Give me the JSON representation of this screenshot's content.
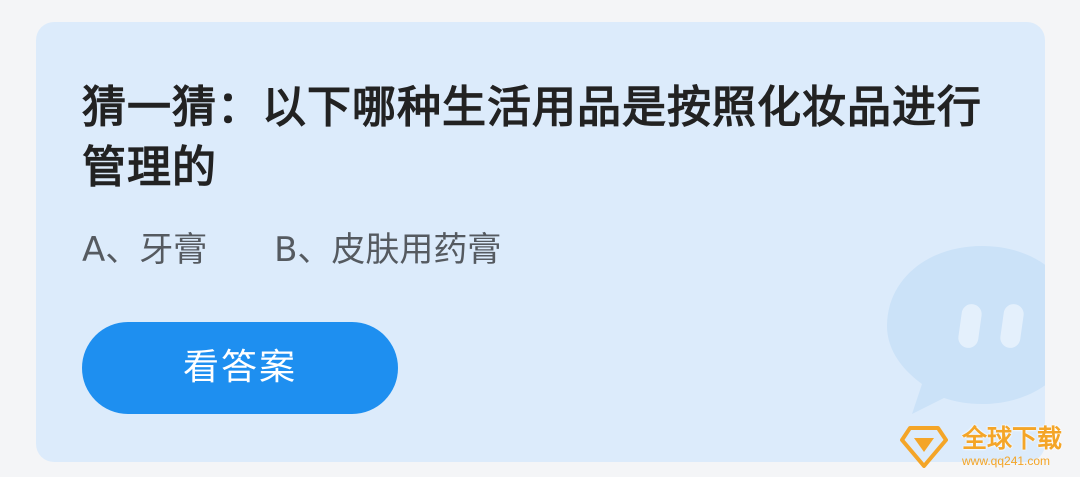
{
  "card": {
    "question": "猜一猜：以下哪种生活用品是按照化妆品进行管理的",
    "options": [
      {
        "label": "A、牙膏"
      },
      {
        "label": "B、皮肤用药膏"
      }
    ],
    "answer_button_label": "看答案"
  },
  "watermark": {
    "title": "全球下载",
    "url": "www.qq241.com"
  },
  "colors": {
    "card_background": "#dcebfb",
    "button_blue": "#1e8ff0",
    "watermark_orange": "#f4a527"
  },
  "icons": {
    "mascot": "chat-bubble-mascot-icon",
    "watermark_logo": "diamond-logo-icon"
  }
}
